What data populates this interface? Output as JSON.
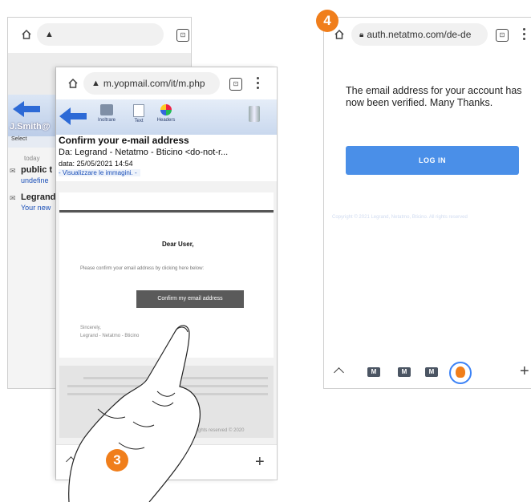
{
  "step3": {
    "number": "3",
    "back_browser": {
      "folder_user": "J.Smith@",
      "select_label": "Select",
      "today_label": "today",
      "rows": [
        {
          "title": "public t",
          "sub": "undefine"
        },
        {
          "title": "Legrand",
          "sub": "Your new"
        }
      ]
    },
    "front_browser": {
      "url": "m.yopmail.com/it/m.php",
      "toolbar": {
        "forward_label": "Inoltrare",
        "text_label": "Text",
        "headers_label": "Headers"
      },
      "email": {
        "subject": "Confirm your e-mail address",
        "from": "Da: Legrand - Netatmo - Bticino <do-not-r...",
        "date": "data: 25/05/2021 14:54",
        "show_images": "- Visualizzare le immagini. -",
        "greeting": "Dear User,",
        "instruction": "Please confirm your email address by clicking here below:",
        "confirm_button": "Confirm my email address",
        "sign_1": "Sincerely,",
        "sign_2": "Legrand - Netatmo - Bticino",
        "footer_fragment": "mo. All rights reserved © 2020"
      },
      "new_tab_symbol": "+"
    }
  },
  "step4": {
    "number": "4",
    "url": "auth.netatmo.com/de-de",
    "message": "The email address for your account has now been verified. Many Thanks.",
    "login_button": "LOG IN",
    "copyright": "Copyright © 2021 Legrand, Netatmo, Bticino. All rights reserved",
    "new_tab_symbol": "+"
  },
  "colors": {
    "badge": "#f07e1b",
    "login_button": "#4a8fe8",
    "yopmail_header": "#cfdcef",
    "yop_link": "#1a4fb8"
  }
}
